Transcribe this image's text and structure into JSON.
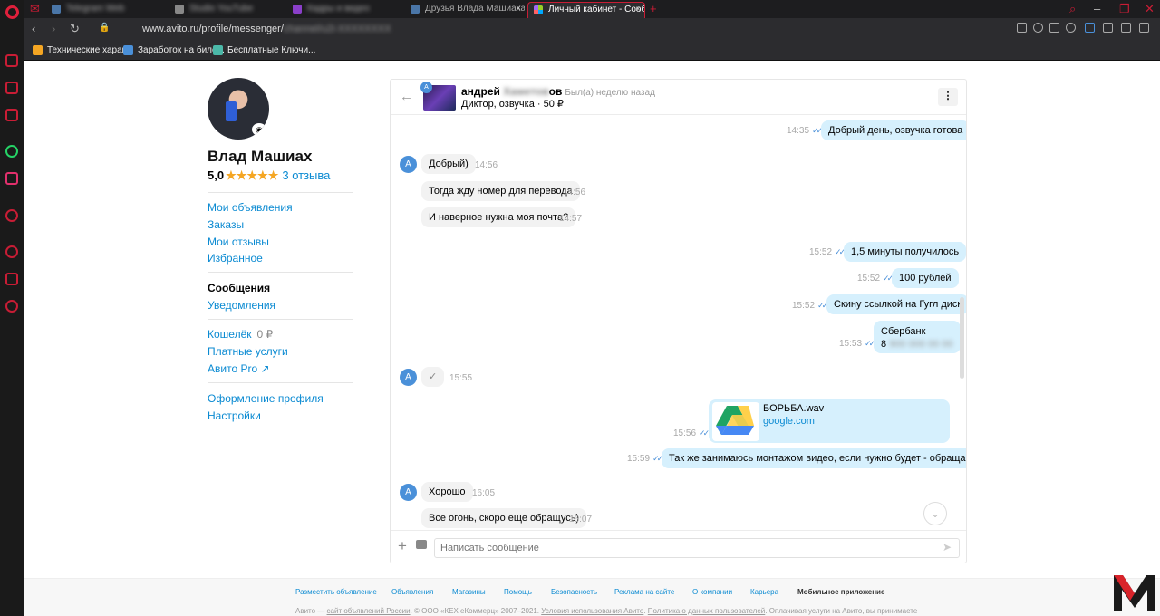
{
  "browser": {
    "tabs": [
      {
        "label": "Telegram Web",
        "blurred": true
      },
      {
        "label": "Studio YouTube",
        "blurred": true
      },
      {
        "label": "Кадры и видео",
        "blurred": true
      },
      {
        "label": "Друзья Влада Машиаха - ",
        "close": "×"
      },
      {
        "label": "Личный кабинет - Сообщ",
        "close": "×",
        "active": true
      }
    ],
    "new_tab": "+",
    "url_visible": "www.avito.ru/profile/messenger/",
    "url_hidden": "channel/u2i-XXXXXXXX",
    "bookmarks": [
      "Технические харак...",
      "Заработок на биле...",
      "Бесплатные Ключи..."
    ]
  },
  "sidebar": {
    "name": "Влад Машиах",
    "rating": "5,0",
    "stars": "★★★★★",
    "reviews": "3 отзыва",
    "links": {
      "ads": "Мои объявления",
      "orders": "Заказы",
      "my_reviews": "Мои отзывы",
      "favorites": "Избранное",
      "messages": "Сообщения",
      "notifications": "Уведомления",
      "wallet": "Кошелёк",
      "wallet_value": "0 ₽",
      "paid": "Платные услуги",
      "avito_pro": "Авито Pro ↗",
      "profile_design": "Оформление профиля",
      "settings": "Настройки"
    }
  },
  "chat": {
    "partner_first": "андрей",
    "partner_hidden": "Хаметов",
    "partner_tail": "ов",
    "last_seen": "Был(а) неделю назад",
    "listing_title": "Диктор, озвучка",
    "listing_price": "50 ₽",
    "avatar_letter": "A",
    "ticks": "✓✓",
    "messages": [
      {
        "dir": "out",
        "text": "Добрый день, озвучка готова",
        "time": "14:35"
      },
      {
        "dir": "in",
        "text": "Добрый)",
        "time": "14:56"
      },
      {
        "dir": "in",
        "text": "Тогда жду номер для перевода",
        "time": "14:56"
      },
      {
        "dir": "in",
        "text": "И наверное нужна моя почта?",
        "time": "14:57"
      },
      {
        "dir": "out",
        "text": "1,5 минуты получилось",
        "time": "15:52"
      },
      {
        "dir": "out",
        "text": "100 рублей",
        "time": "15:52"
      },
      {
        "dir": "out",
        "text": "Скину ссылкой на Гугл диск",
        "time": "15:52"
      },
      {
        "dir": "out",
        "text": "Сбербанк",
        "text2": "8",
        "text2_hidden": "900 000 00 00",
        "time": "15:53"
      },
      {
        "dir": "in",
        "text": "✓",
        "time": "15:55"
      },
      {
        "dir": "out",
        "file": "БОРЬБА.wav",
        "host": "google.com",
        "time": "15:56"
      },
      {
        "dir": "out",
        "text": "Так же занимаюсь монтажом видео, если нужно будет - обращайтесь",
        "time": "15:59"
      },
      {
        "dir": "in",
        "text": "Хорошо",
        "time": "16:05"
      },
      {
        "dir": "in",
        "text": "Все огонь, скоро еще обращусь)",
        "time": "16:07"
      }
    ],
    "input_placeholder": "Написать сообщение"
  },
  "footer": {
    "links": [
      "Разместить объявление",
      "Объявления",
      "Магазины",
      "Помощь",
      "Безопасность",
      "Реклама на сайте",
      "О компании",
      "Карьера",
      "Мобильное приложение"
    ],
    "copyright": {
      "t1": "Авито — ",
      "l1": "сайт объявлений России",
      "t2": ". © ООО «КЕХ еКоммерц» 2007–2021. ",
      "l2": "Условия использования Авито",
      "t3": ". ",
      "l3": "Политика о данных пользователей",
      "t4": ". Оплачивая услуги на Авито, вы принимаете"
    }
  },
  "colors": {
    "accent": "#0a8ad2",
    "out_bubble": "#d6f0fd",
    "in_bubble": "#f2f2f2",
    "stars": "#f5a623",
    "opera_red": "#e0203b"
  }
}
